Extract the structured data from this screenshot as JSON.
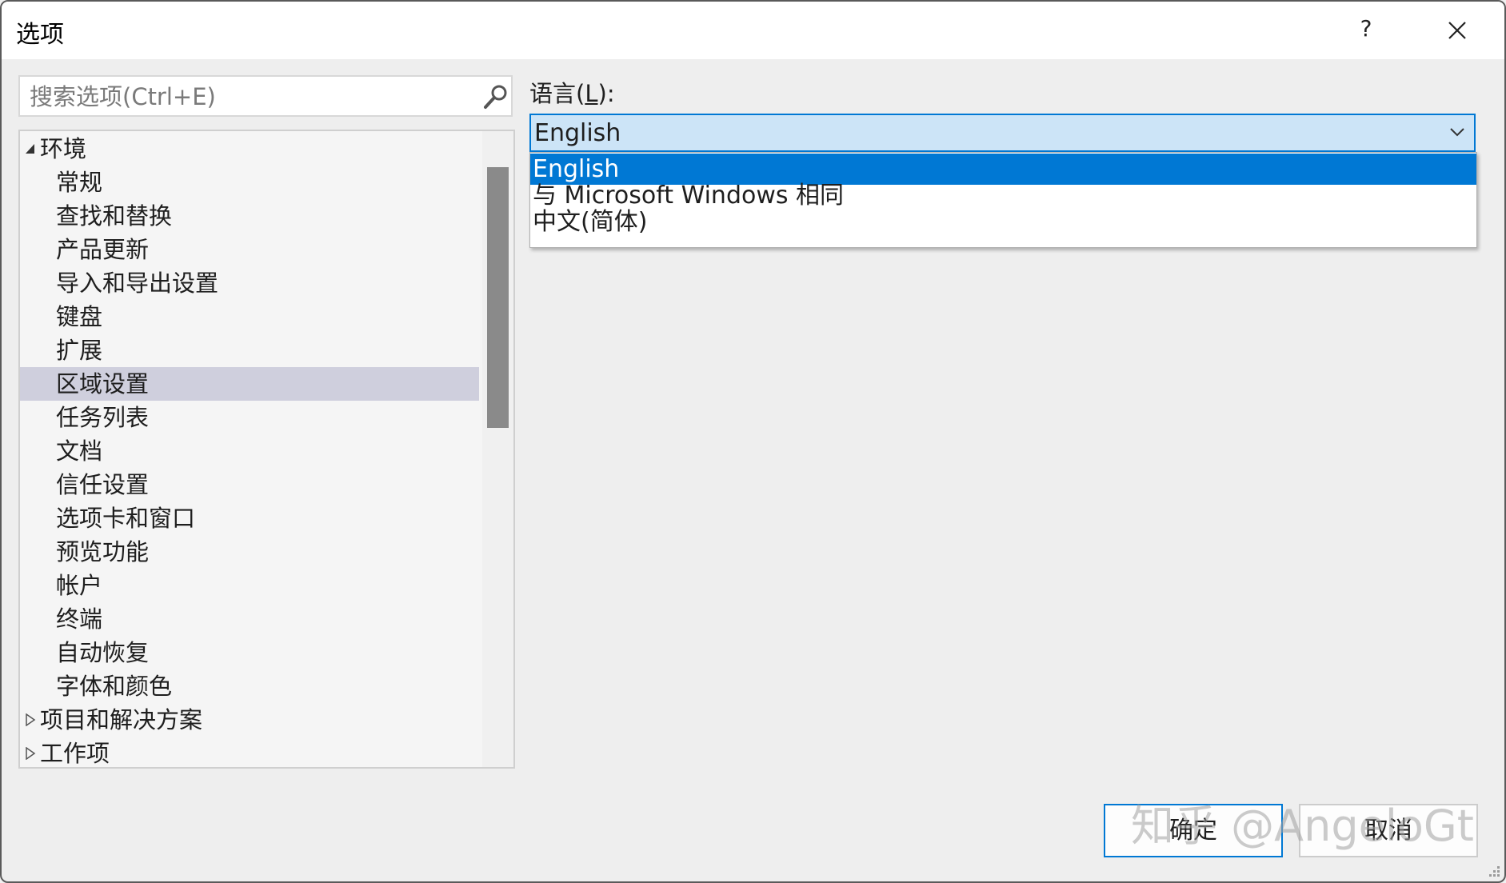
{
  "window": {
    "title": "选项",
    "help_label": "?"
  },
  "search": {
    "placeholder": "搜索选项(Ctrl+E)",
    "value": ""
  },
  "tree": {
    "root": "环境",
    "children": [
      "常规",
      "查找和替换",
      "产品更新",
      "导入和导出设置",
      "键盘",
      "扩展",
      "区域设置",
      "任务列表",
      "文档",
      "信任设置",
      "选项卡和窗口",
      "预览功能",
      "帐户",
      "终端",
      "自动恢复",
      "字体和颜色"
    ],
    "selected": "区域设置",
    "collapsed_roots": [
      "项目和解决方案",
      "工作项"
    ]
  },
  "language": {
    "label_prefix": "语言(",
    "label_key": "L",
    "label_suffix": "):",
    "selected": "English",
    "options": [
      "English",
      "与 Microsoft Windows 相同",
      "中文(简体)"
    ]
  },
  "buttons": {
    "ok": "确定",
    "cancel": "取消"
  },
  "watermark": "知乎 @AngeloGt",
  "colors": {
    "accent": "#0078d4",
    "combo_background": "#cce4f7",
    "selected_tree_item": "#cfcfdd"
  }
}
